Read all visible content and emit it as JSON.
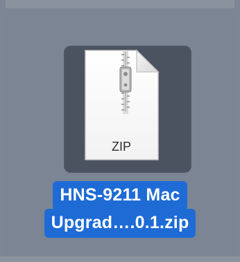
{
  "desktop": {
    "background_color": "#7b8593",
    "selection_color": "#4c5360",
    "label_highlight_color": "#1e6bd6"
  },
  "file": {
    "icon": "zip-file-icon",
    "icon_text": "ZIP",
    "name_line_1": "HNS-9211 Mac",
    "name_line_2": "Upgrad….0.1.zip",
    "selected": true
  }
}
